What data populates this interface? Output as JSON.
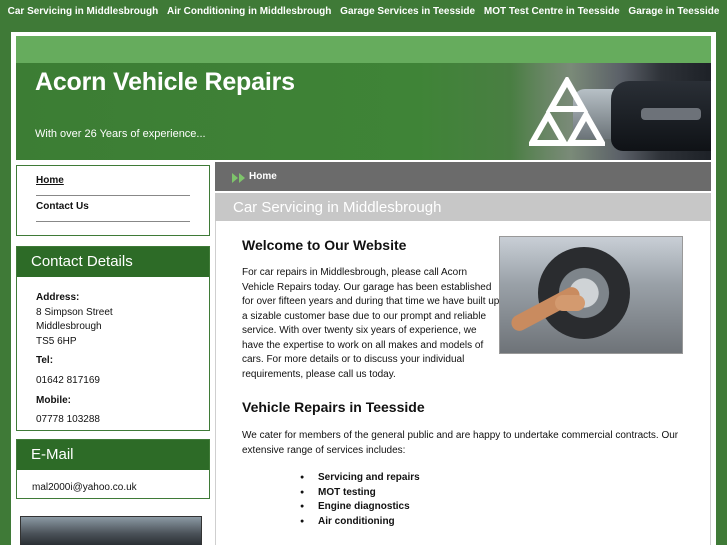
{
  "top_nav": {
    "items": [
      "Car Servicing in Middlesbrough",
      "Air Conditioning in Middlesbrough",
      "Garage Services in Teesside",
      "MOT Test Centre in Teesside",
      "Garage in Teesside"
    ]
  },
  "header": {
    "title": "Acorn Vehicle Repairs",
    "tagline": "With over 26 Years of experience..."
  },
  "sidebar": {
    "nav": [
      "Home",
      "Contact Us"
    ],
    "contact": {
      "heading": "Contact Details",
      "address_label": "Address:",
      "address_lines": [
        "8 Simpson Street",
        "Middlesbrough",
        "TS5 6HP"
      ],
      "tel_label": "Tel:",
      "tel": "01642 817169",
      "mobile_label": "Mobile:",
      "mobile": "07778 103288"
    },
    "email": {
      "heading": "E-Mail",
      "address": "mal2000i@yahoo.co.uk"
    }
  },
  "breadcrumb": "Home",
  "page_heading": "Car Servicing in Middlesbrough",
  "main": {
    "welcome_title": "Welcome to Our Website",
    "welcome_text": "For car repairs in Middlesbrough, please call Acorn Vehicle Repairs today. Our garage has been established for over fifteen years and during that time we have built up a sizable customer base due to our prompt and reliable service. With over twenty six years of experience, we have the expertise to work on all makes and models of cars. For more details or to discuss your individual requirements, please call us today.",
    "repairs_title": "Vehicle Repairs in Teesside",
    "repairs_text": "We cater for members of the general public and are happy to undertake commercial contracts. Our extensive range of services includes:",
    "services": [
      "Servicing and repairs",
      "MOT testing",
      "Engine diagnostics",
      "Air conditioning"
    ]
  },
  "colors": {
    "background_green": "#3f7a37",
    "light_green_bar": "#66ac5d",
    "section_head_green": "#2d6b27",
    "breadcrumb_grey": "#6b6b6b",
    "heading_bar_grey": "#c7c7c7",
    "arrow_green": "#7ec46b"
  },
  "icons": [
    "mot-triangles-logo",
    "double-arrow-icon",
    "tyre-photo",
    "car-photo"
  ]
}
